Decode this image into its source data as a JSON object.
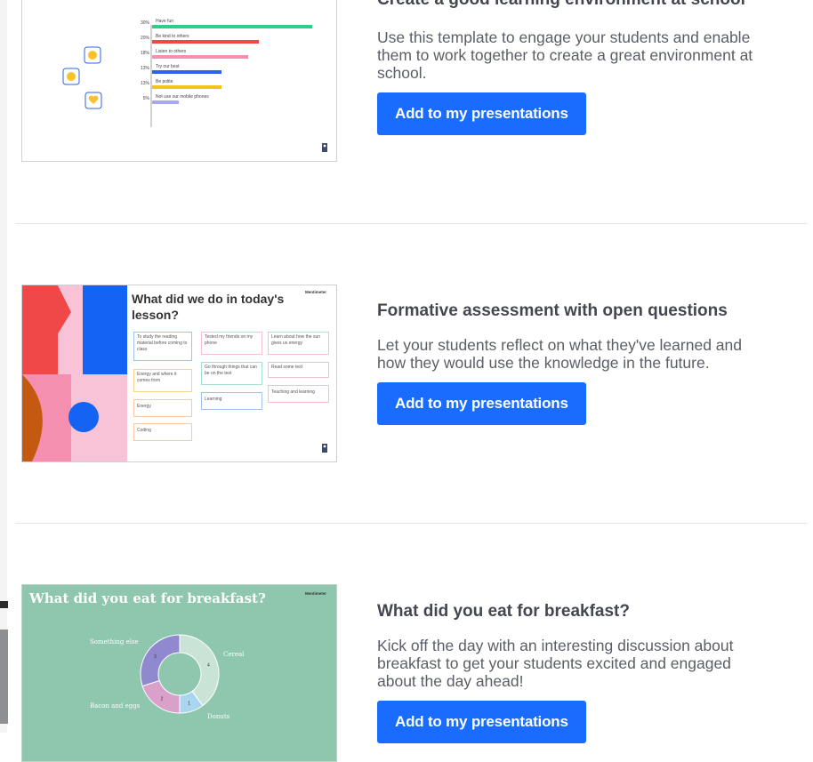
{
  "templates": [
    {
      "title": "Create a good learning environment at school",
      "description": "Use this template to engage your students and enable them to work together to create a great environment at school.",
      "button_label": "Add to my presentations",
      "preview": {
        "chart_data": {
          "type": "bar",
          "categories": [
            "Have fun",
            "Be kind to others",
            "Listen to others",
            "Try our best",
            "Be polite",
            "Not use our mobile phones"
          ],
          "values": [
            30,
            20,
            18,
            13,
            13,
            5
          ],
          "value_labels": [
            "30%",
            "20%",
            "18%",
            "13%",
            "13%",
            "5%"
          ],
          "colors": [
            "#2ecf8a",
            "#f04848",
            "#f58fb0",
            "#2d63e6",
            "#f4c21a",
            "#a7a9f0"
          ],
          "xlim": [
            0,
            30
          ]
        }
      }
    },
    {
      "title": "Formative assessment with open questions",
      "description": "Let your students reflect on what they've learned and how they would use the knowledge in the future.",
      "button_label": "Add to my presentations",
      "preview": {
        "heading": "What did we do in today's lesson?",
        "brand": "Mentimeter",
        "notes": [
          "To study the reading material before coming to class",
          "Tested my friends on my phone",
          "Learn about how the sun gives us energy",
          "Energy and where it comes from",
          "Go through things that can be on the test",
          "Read some text",
          "Energy",
          "Learning",
          "Teaching and learning",
          "Coding"
        ]
      }
    },
    {
      "title": "What did you eat for breakfast?",
      "description": "Kick off the day with an interesting discussion about breakfast to get your students excited and engaged about the day ahead!",
      "button_label": "Add to my presentations",
      "preview": {
        "heading": "What did you eat for breakfast?",
        "brand": "Mentimeter",
        "chart_data": {
          "type": "pie",
          "categories": [
            "Cereal",
            "Donuts",
            "Bacon and eggs",
            "Something else"
          ],
          "values": [
            4,
            1,
            2,
            3
          ],
          "colors": [
            "#c9e4d7",
            "#a9d6ee",
            "#d9a0cc",
            "#9089cf"
          ]
        }
      }
    }
  ]
}
